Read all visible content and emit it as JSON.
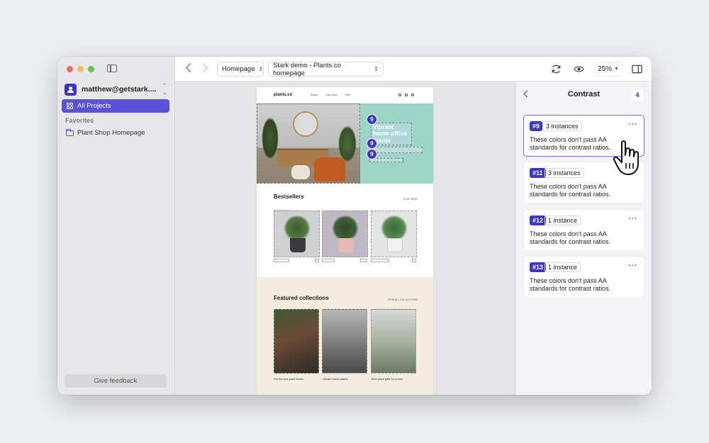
{
  "sidebar": {
    "account": "matthew@getstark....",
    "nav_active": "All Projects",
    "section_label": "Favorites",
    "favorite": "Plant Shop Homepage",
    "feedback": "Give feedback"
  },
  "toolbar": {
    "page_select": "Homepage",
    "file_select": "Stark demo - Plants.co homepage",
    "zoom": "25%"
  },
  "canvas": {
    "logo": "plants.co",
    "nav": [
      "Plants",
      "Care tools",
      "Gifts"
    ],
    "hero_text": "Vibrant home office plants",
    "badge": "9",
    "bestsellers": "Bestsellers",
    "shop_now": "SHOP NOW",
    "featured": "Featured collections",
    "view_all": "VIEW ALL COLLECTIONS",
    "captions": [
      "For the true plant lovers",
      "Vibrant home plants",
      "Best plant gifts for moms"
    ]
  },
  "panel": {
    "title": "Contrast",
    "count": "4",
    "issues": [
      {
        "id": "#9",
        "instances": "3 instances",
        "desc": "These colors don't pass AA standards for contrast ratios."
      },
      {
        "id": "#11",
        "instances": "3 instances",
        "desc": "These colors don't pass AA standards for contrast ratios."
      },
      {
        "id": "#12",
        "instances": "1 instance",
        "desc": "These colors don't pass AA standards for contrast ratios."
      },
      {
        "id": "#13",
        "instances": "1 instance",
        "desc": "These colors don't pass AA standards for contrast ratios."
      }
    ]
  },
  "colors": {
    "accent": "#3d35c6",
    "sidebar_active": "#5b50d8",
    "hero_teal": "#9cd5c6",
    "featured_bg": "#f4ece1"
  }
}
